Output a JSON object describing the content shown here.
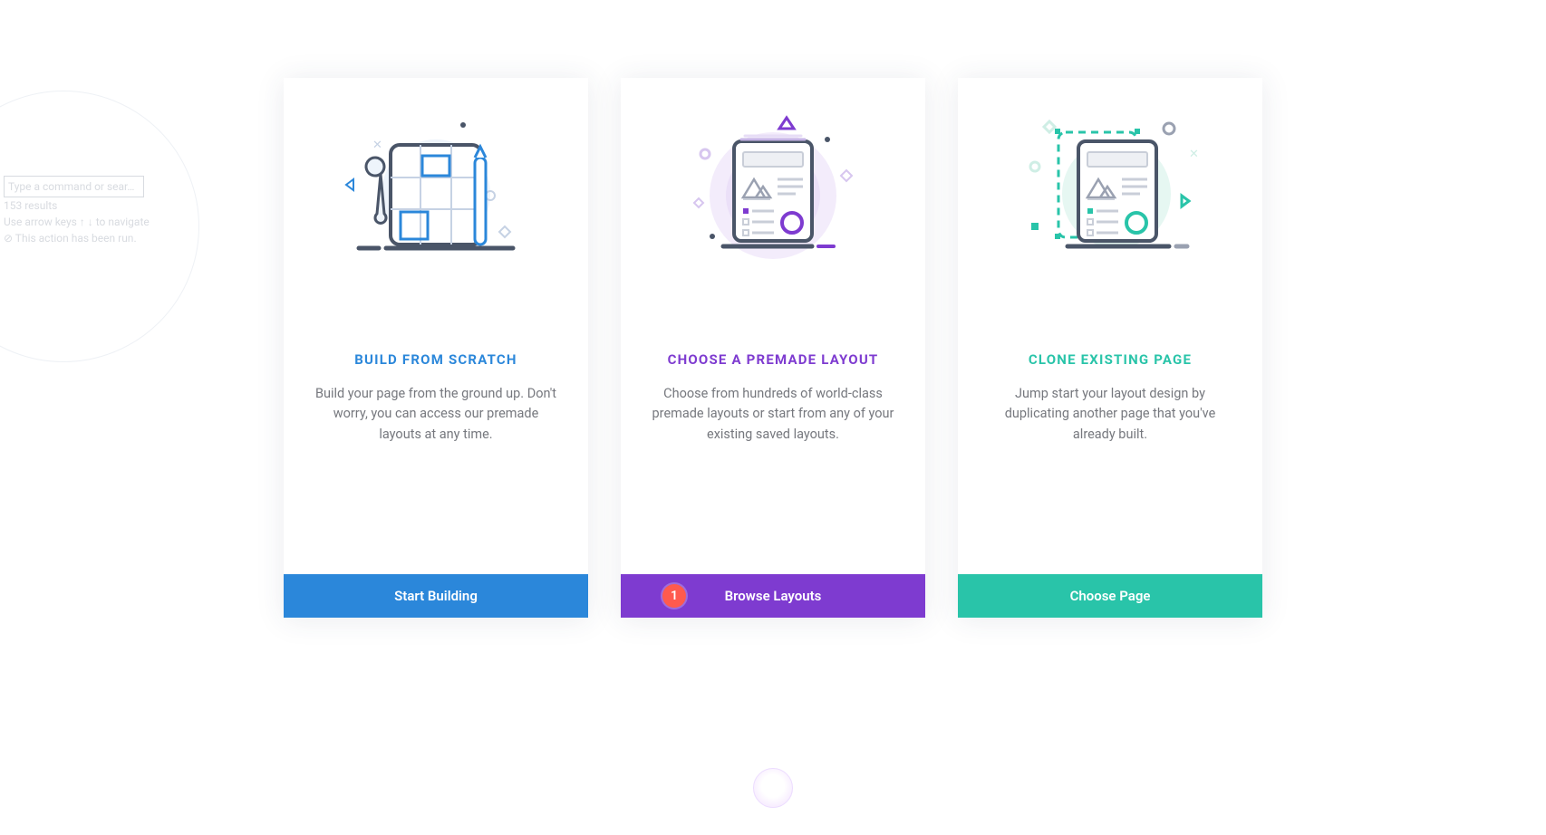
{
  "background": {
    "hint_box": "Type a command or sear…",
    "line1": "153 results",
    "line2": "Use arrow keys ↑ ↓ to navigate",
    "line3": "⊘ This action has been run."
  },
  "cards": [
    {
      "title": "BUILD FROM SCRATCH",
      "desc": "Build your page from the ground up. Don't worry, you can access our premade layouts at any time.",
      "button": "Start Building"
    },
    {
      "title": "CHOOSE A PREMADE LAYOUT",
      "desc": "Choose from hundreds of world-class premade layouts or start from any of your existing saved layouts.",
      "button": "Browse Layouts",
      "badge": "1"
    },
    {
      "title": "CLONE EXISTING PAGE",
      "desc": "Jump start your layout design by duplicating another page that you've already built.",
      "button": "Choose Page"
    }
  ],
  "colors": {
    "blue": "#2b87da",
    "purple": "#7e3bd0",
    "teal": "#29c4a9",
    "badge": "#ff5a4e"
  }
}
